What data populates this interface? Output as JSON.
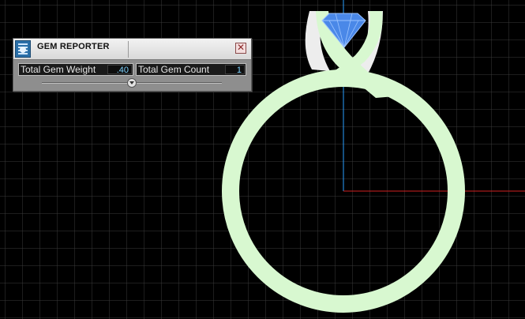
{
  "panel": {
    "title": "GEM REPORTER",
    "close_glyph": "✕",
    "logo_icon": "gem-reporter-logo-icon",
    "fields": [
      {
        "label": "Total Gem Weight",
        "value": ".40"
      },
      {
        "label": "Total Gem Count",
        "value": "1"
      }
    ]
  },
  "colors": {
    "background": "#000000",
    "grid": "#3a3a3a",
    "ring": "#d8f8d0",
    "gem": "#4a88e8",
    "axis_x": "#d02020",
    "axis_y": "#2aa0ff",
    "value_text": "#7fd3ff"
  }
}
